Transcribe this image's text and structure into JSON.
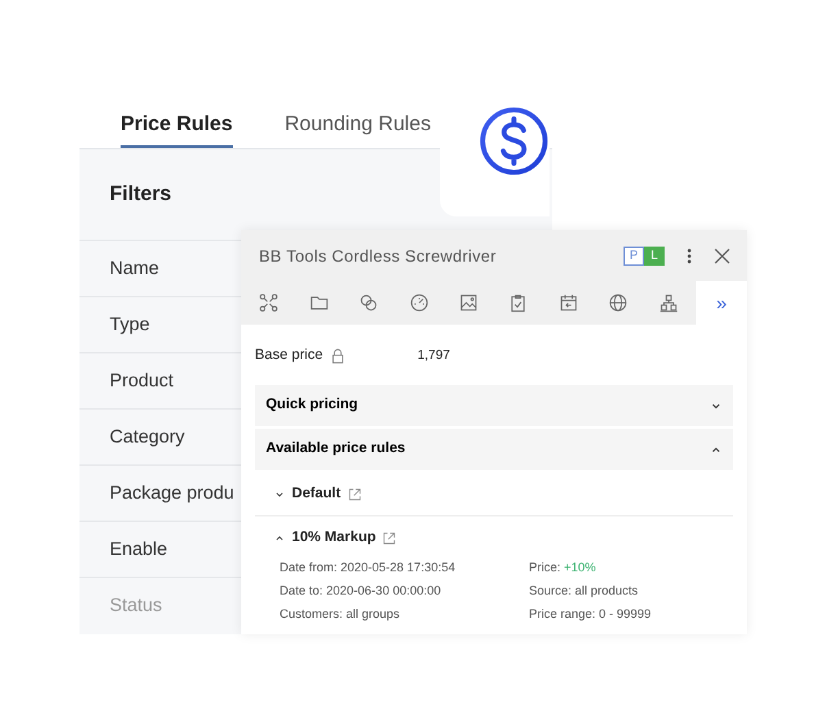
{
  "tabs": [
    {
      "label": "Price Rules",
      "selected": true
    },
    {
      "label": "Rounding Rules",
      "selected": false
    }
  ],
  "filters": {
    "title": "Filters",
    "rows": [
      {
        "label": "Name",
        "disabled": false
      },
      {
        "label": "Type",
        "disabled": false
      },
      {
        "label": "Product",
        "disabled": false
      },
      {
        "label": "Category",
        "disabled": false
      },
      {
        "label": "Package produ",
        "disabled": false
      },
      {
        "label": "Enable",
        "disabled": false
      },
      {
        "label": "Status",
        "disabled": true
      }
    ]
  },
  "popup": {
    "title": "BB Tools Cordless Screwdriver",
    "badges": [
      {
        "label": "P",
        "selected": false
      },
      {
        "label": "L",
        "selected": true
      }
    ],
    "toolbar": {
      "icons": [
        {
          "kind": "nodes"
        },
        {
          "kind": "folder"
        },
        {
          "kind": "link"
        },
        {
          "kind": "gauge"
        },
        {
          "kind": "image"
        },
        {
          "kind": "clipboard"
        },
        {
          "kind": "calendar"
        },
        {
          "kind": "globe"
        },
        {
          "kind": "hierarchy"
        }
      ],
      "more": "»"
    },
    "base_price": {
      "label": "Base price",
      "value": "1,797",
      "locked": true
    },
    "sections": [
      {
        "title": "Quick pricing",
        "expanded": false
      },
      {
        "title": "Available price rules",
        "expanded": true
      }
    ],
    "rules": [
      {
        "name": "Default",
        "expanded": false
      },
      {
        "name": "10% Markup",
        "expanded": true,
        "details": [
          {
            "label": "Date from:",
            "value": "2020-05-28 17:30:54",
            "highlight": false
          },
          {
            "label": "Price:",
            "value": "+10%",
            "highlight": true
          },
          {
            "label": "Date to:",
            "value": "2020-06-30 00:00:00",
            "highlight": false
          },
          {
            "label": "Source:",
            "value": "all products",
            "highlight": false
          },
          {
            "label": "Customers:",
            "value": "all groups",
            "highlight": false
          },
          {
            "label": "Price range:",
            "value": "0 - 99999",
            "highlight": false
          }
        ]
      }
    ]
  }
}
